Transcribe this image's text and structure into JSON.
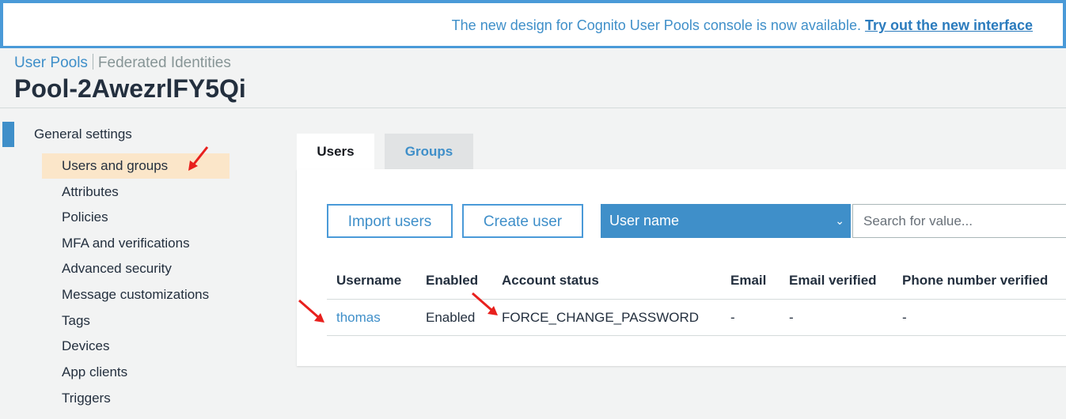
{
  "banner": {
    "text": "The new design for Cognito User Pools console is now available. ",
    "link_text": "Try out the new interface"
  },
  "top_nav": {
    "user_pools": "User Pools",
    "federated_identities": "Federated Identities"
  },
  "page_title": "Pool-2AwezrlFY5Qi",
  "sidebar": {
    "heading": "General settings",
    "items": [
      {
        "label": "Users and groups",
        "active": true
      },
      {
        "label": "Attributes"
      },
      {
        "label": "Policies"
      },
      {
        "label": "MFA and verifications"
      },
      {
        "label": "Advanced security"
      },
      {
        "label": "Message customizations"
      },
      {
        "label": "Tags"
      },
      {
        "label": "Devices"
      },
      {
        "label": "App clients"
      },
      {
        "label": "Triggers"
      }
    ]
  },
  "tabs": [
    {
      "label": "Users",
      "active": true
    },
    {
      "label": "Groups"
    }
  ],
  "toolbar": {
    "import_label": "Import users",
    "create_label": "Create user",
    "filter_selected": "User name",
    "search_placeholder": "Search for value..."
  },
  "table": {
    "columns": [
      "Username",
      "Enabled",
      "Account status",
      "Email",
      "Email verified",
      "Phone number verified"
    ],
    "rows": [
      [
        "thomas",
        "Enabled",
        "FORCE_CHANGE_PASSWORD",
        "-",
        "-",
        "-"
      ]
    ]
  },
  "colors": {
    "accent": "#3f8fc9",
    "active_item_bg": "#fbe6c9",
    "annotation_arrow": "#e8201d"
  }
}
